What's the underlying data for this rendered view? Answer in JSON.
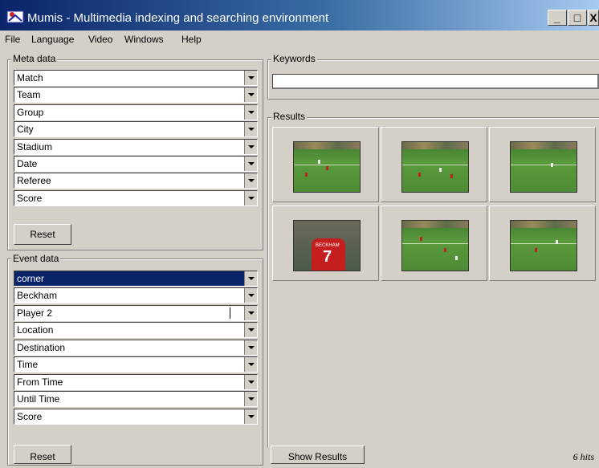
{
  "window": {
    "title": "Mumis - Multimedia indexing and searching environment"
  },
  "menu": [
    "File",
    "Language",
    "Video",
    "Windows",
    "Help"
  ],
  "meta": {
    "label": "Meta data",
    "fields": [
      "Match",
      "Team",
      "Group",
      "City",
      "Stadium",
      "Date",
      "Referee",
      "Score"
    ],
    "reset": "Reset"
  },
  "event": {
    "label": "Event data",
    "fields": [
      "corner",
      "Beckham",
      "Player 2",
      "Location",
      "Destination",
      "Time",
      "From Time",
      "Until Time",
      "Score"
    ],
    "reset": "Reset"
  },
  "keywords": {
    "label": "Keywords",
    "value": ""
  },
  "results": {
    "label": "Results",
    "hits": "6 hits",
    "show_button": "Show Results",
    "thumb_jersey": "BECKHAM",
    "thumb_number": "7"
  },
  "colors": {
    "selection": "#0a246a",
    "field_green": "#4f8c35"
  }
}
